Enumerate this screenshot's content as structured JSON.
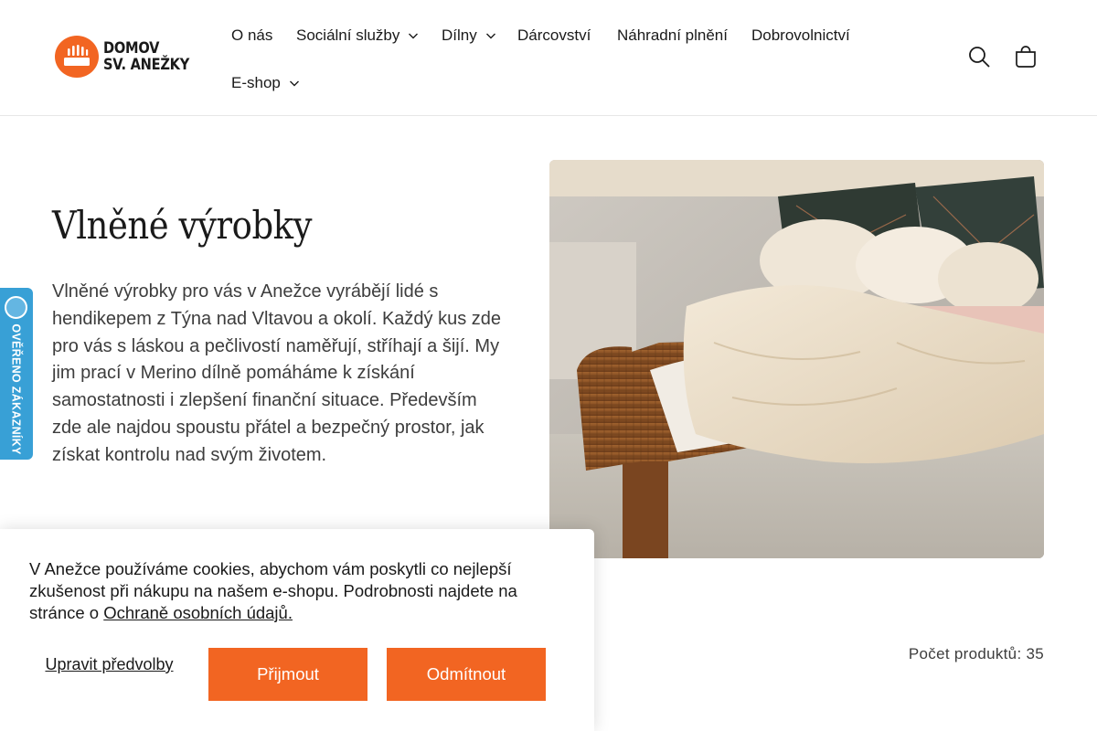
{
  "logo": {
    "line1": "DOMOV",
    "line2": "SV. ANEŽKY",
    "color": "#f26522"
  },
  "nav": {
    "items": [
      {
        "label": "O nás",
        "dropdown": false
      },
      {
        "label": "Sociální služby",
        "dropdown": true
      },
      {
        "label": "Dílny",
        "dropdown": true
      },
      {
        "label": "Dárcovství",
        "dropdown": false
      },
      {
        "label": "Náhradní plnění",
        "dropdown": false
      },
      {
        "label": "Dobrovolnictví",
        "dropdown": false
      },
      {
        "label": "E-shop",
        "dropdown": true
      }
    ]
  },
  "header_icons": [
    "search-icon",
    "cart-icon"
  ],
  "hero": {
    "title": "Vlněné výrobky",
    "text": "Vlněné výrobky pro vás v Anežce vyrábějí lidé s hendikepem z Týna nad Vltavou a okolí. Každý kus zde pro vás s láskou a pečlivostí naměřují, stříhají a šijí. My jim prací v Merino dílně pomáháme k získání samostatnosti i zlepšení finanční situace. Především zde ale najdou spoustu přátel a bezpečný prostor, jak získat kontrolu nad svým životem."
  },
  "badge": {
    "label": "OVĚŘENO ZÁKAZNÍKY",
    "color": "#38a0d6"
  },
  "products": {
    "count_label": "Počet produktů: 35"
  },
  "cookie": {
    "text": "V Anežce používáme cookies, abychom vám poskytli co nejlepší zkušenost při nákupu na našem e-shopu. Podrobnosti najdete na stránce o ",
    "link": "Ochraně osobních údajů.",
    "settings_label": "Upravit předvolby",
    "accept_label": "Přijmout",
    "reject_label": "Odmítnout",
    "button_color": "#f26522"
  }
}
